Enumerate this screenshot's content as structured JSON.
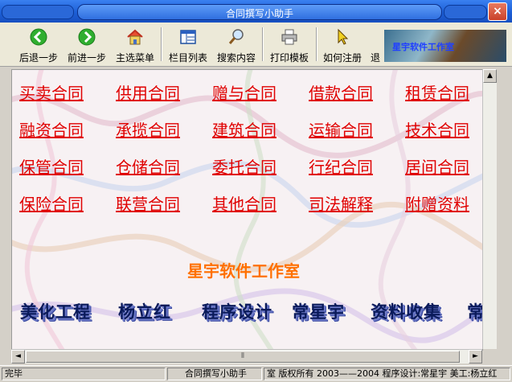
{
  "window": {
    "title": "合同撰写小助手",
    "close_label": "×"
  },
  "toolbar": {
    "buttons": [
      {
        "label": "后退一步",
        "icon": "back-arrow-icon"
      },
      {
        "label": "前进一步",
        "icon": "forward-arrow-icon"
      },
      {
        "label": "主选菜单",
        "icon": "home-icon"
      },
      {
        "label": "栏目列表",
        "icon": "list-icon"
      },
      {
        "label": "搜索内容",
        "icon": "search-icon"
      },
      {
        "label": "打印模板",
        "icon": "printer-icon"
      },
      {
        "label": "如何注册",
        "icon": "cursor-icon"
      },
      {
        "label": "退"
      }
    ],
    "banner_text": "星宇软件工作室"
  },
  "contracts": [
    [
      "买卖合同",
      "供用合同",
      "赠与合同",
      "借款合同",
      "租赁合同"
    ],
    [
      "融资合同",
      "承揽合同",
      "建筑合同",
      "运输合同",
      "技术合同"
    ],
    [
      "保管合同",
      "仓储合同",
      "委托合同",
      "行纪合同",
      "居间合同"
    ],
    [
      "保险合同",
      "联营合同",
      "其他合同",
      "司法解释",
      "附赠资料"
    ]
  ],
  "studio_name": "星宇软件工作室",
  "credits": [
    "美化工程",
    "杨立红",
    "程序设计",
    "常星宇",
    "资料收集",
    "常"
  ],
  "scroll": {
    "up": "▲",
    "left": "◄",
    "right": "►",
    "grip": "⦀"
  },
  "status": {
    "state": "完毕",
    "app": "合同撰写小助手",
    "copyright": "室 版权所有 2003——2004 程序设计:常星宇 美工:杨立红"
  },
  "colors": {
    "link": "#e00000",
    "studio": "#ff7000",
    "titlebar": "#1c5fd6"
  }
}
